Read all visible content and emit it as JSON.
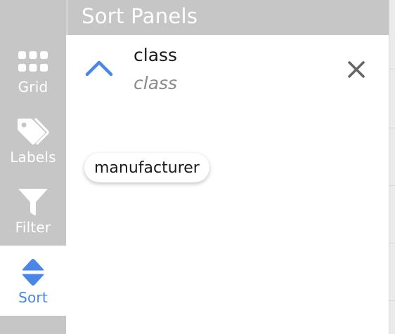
{
  "panel": {
    "title": "Sort Panels"
  },
  "sidebar": {
    "items": [
      {
        "label": "Grid",
        "icon": "grid-icon",
        "active": false
      },
      {
        "label": "Labels",
        "icon": "tag-icon",
        "active": false
      },
      {
        "label": "Filter",
        "icon": "filter-icon",
        "active": false
      },
      {
        "label": "Sort",
        "icon": "sort-icon",
        "active": true
      }
    ]
  },
  "sort": {
    "active": [
      {
        "field": "class",
        "subtitle": "class",
        "direction": "ascending",
        "direction_icon": "chevron-up-icon",
        "remove_icon": "close-icon"
      }
    ],
    "available": [
      {
        "label": "manufacturer"
      }
    ]
  },
  "colors": {
    "sidebar_bg": "#c6c6c6",
    "accent": "#4a86e8",
    "text": "#1a1a1a",
    "muted_text": "#8a8a8a",
    "close_icon": "#666666"
  }
}
